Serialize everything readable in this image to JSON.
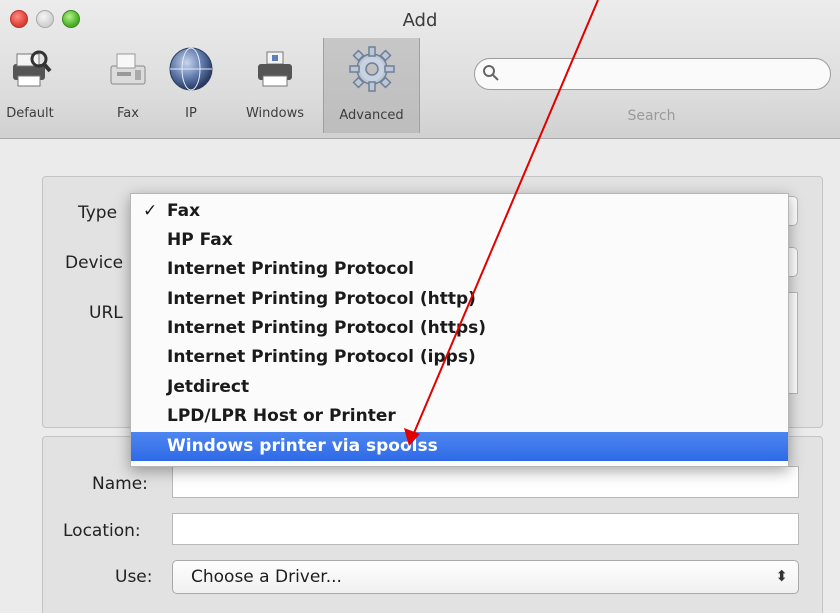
{
  "window": {
    "title": "Add"
  },
  "toolbar": {
    "items": [
      {
        "label": "Default",
        "icon": "printer-magnifier-icon"
      },
      {
        "label": "Fax",
        "icon": "fax-icon"
      },
      {
        "label": "IP",
        "icon": "globe-icon"
      },
      {
        "label": "Windows",
        "icon": "windows-printer-icon"
      },
      {
        "label": "Advanced",
        "icon": "gear-icon"
      }
    ],
    "active": "Advanced",
    "search_label": "Search"
  },
  "form": {
    "type_label": "Type",
    "device_label": "Device",
    "url_label": "URL",
    "name_label": "Name:",
    "location_label": "Location:",
    "use_label": "Use:",
    "use_value": "Choose a Driver...",
    "use_arrows": "⬍"
  },
  "type_menu": {
    "checkmark": "✓",
    "checked": "Fax",
    "selected": "Windows printer via spoolss",
    "items": [
      "Fax",
      "HP Fax",
      "Internet Printing Protocol",
      "Internet Printing Protocol (http)",
      "Internet Printing Protocol (https)",
      "Internet Printing Protocol (ipps)",
      "Jetdirect",
      "LPD/LPR Host or Printer",
      "Windows printer via spoolss"
    ]
  },
  "colors": {
    "highlight": "#2f6ae6",
    "annotation_arrow": "#e00000"
  }
}
